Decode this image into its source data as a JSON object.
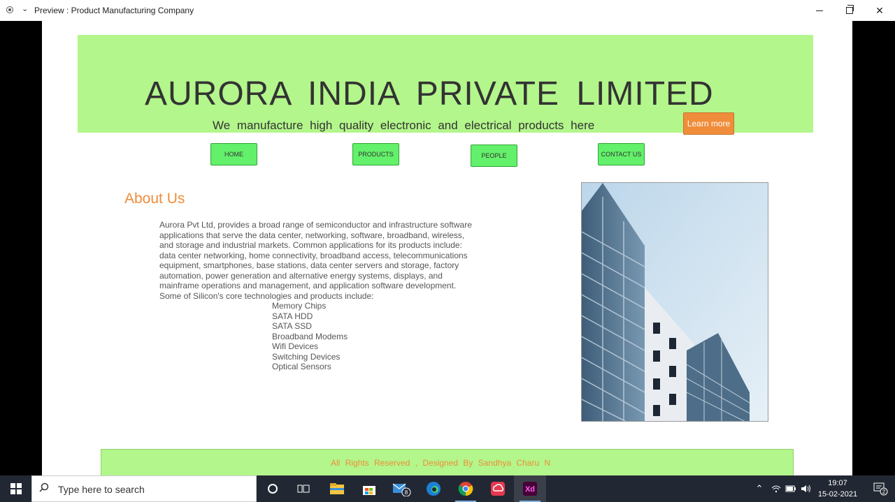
{
  "window": {
    "title": "Preview : Product Manufacturing Company"
  },
  "site": {
    "company_name": "AURORA  INDIA  PRIVATE  LIMITED",
    "tagline": "We  manufacture  high  quality  electronic  and  electrical  products  here",
    "learn_more": "Learn more",
    "nav": {
      "home": "HOME",
      "products": "PRODUCTS",
      "people": "PEOPLE",
      "contact": "CONTACT US"
    },
    "about_title": "About Us",
    "about_text": " Aurora Pvt Ltd, provides a broad range of semiconductor and infrastructure software applications that serve the data center, networking, software, broadband, wireless, and storage and industrial markets. Common applications for its products include: data center networking, home connectivity, broadband access, telecommunications equipment, smartphones, base stations, data center servers and storage, factory automation, power generation and alternative energy systems, displays, and mainframe operations and management, and application software development. Some of Silicon's core technologies and products include:",
    "products": [
      "Memory Chips",
      "SATA HDD",
      "SATA SSD",
      "Broadband Modems",
      "Wifi Devices",
      "Switching Devices",
      "Optical Sensors"
    ],
    "footer": "All  Rights  Reserved ,  Designed  By  Sandhya Charu N"
  },
  "taskbar": {
    "search_placeholder": "Type here to search",
    "mail_badge": "8",
    "time": "19:07",
    "date": "15-02-2021",
    "notification_count": "2"
  },
  "colors": {
    "header_bg": "#b3f68b",
    "accent_orange": "#ef8d3a",
    "nav_green": "#63f06a"
  }
}
